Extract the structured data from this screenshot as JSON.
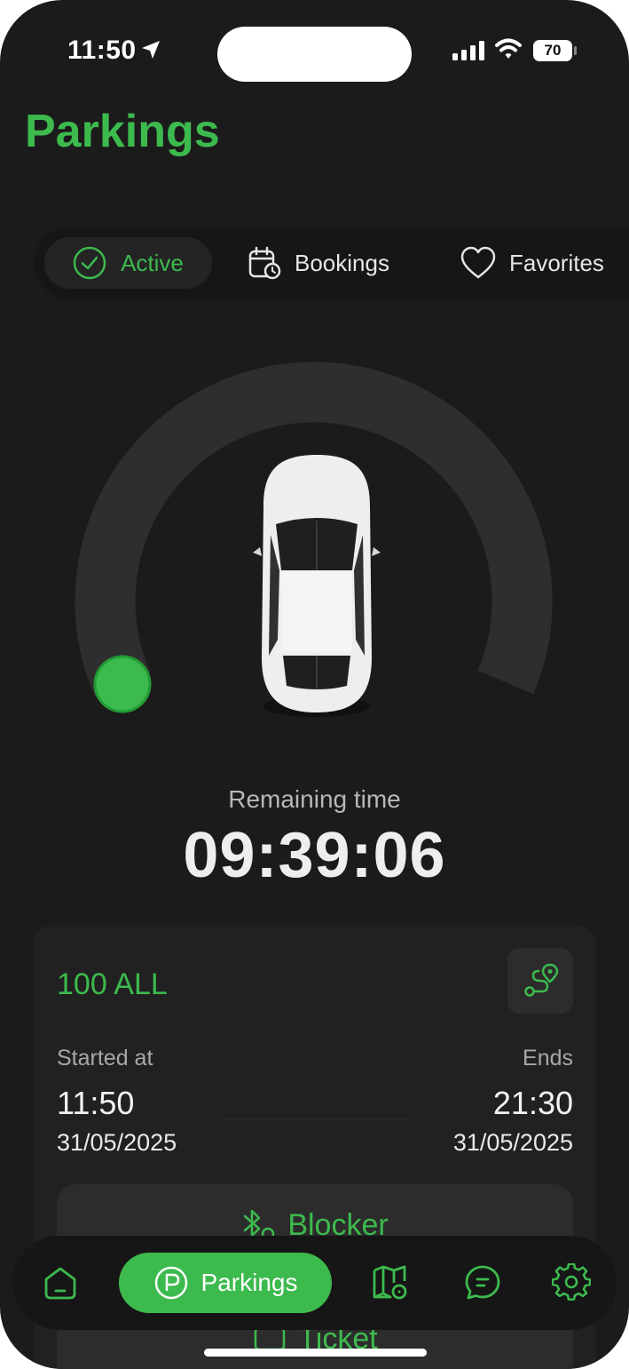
{
  "status_bar": {
    "time": "11:50",
    "battery": "70"
  },
  "header": {
    "title": "Parkings"
  },
  "tabs": [
    {
      "label": "Active",
      "icon": "check-circle-icon",
      "selected": true
    },
    {
      "label": "Bookings",
      "icon": "calendar-clock-icon",
      "selected": false
    },
    {
      "label": "Favorites",
      "icon": "heart-icon",
      "selected": false
    }
  ],
  "timer": {
    "label": "Remaining time",
    "value": "09:39:06",
    "progress_fraction": 0.0
  },
  "session": {
    "price": "100 ALL",
    "started_label": "Started at",
    "ends_label": "Ends",
    "start_time": "11:50",
    "start_date": "31/05/2025",
    "end_time": "21:30",
    "end_date": "31/05/2025",
    "blocker_label": "Blocker",
    "ticket_label": "Ticket"
  },
  "bottom_nav": {
    "items": [
      {
        "label": "",
        "icon": "home-icon"
      },
      {
        "label": "Parkings",
        "icon": "parking-icon",
        "selected": true
      },
      {
        "label": "",
        "icon": "map-pin-icon"
      },
      {
        "label": "",
        "icon": "chat-icon"
      },
      {
        "label": "",
        "icon": "gear-icon"
      }
    ]
  },
  "colors": {
    "accent": "#3dba4e",
    "background": "#1b1b1b",
    "card": "#212121"
  }
}
